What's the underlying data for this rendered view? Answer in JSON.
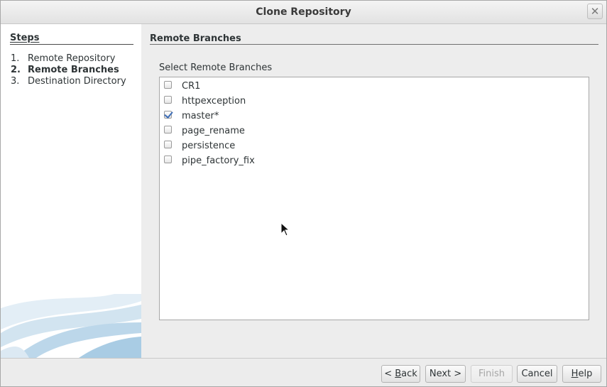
{
  "window": {
    "title": "Clone Repository",
    "close_glyph": "✕"
  },
  "steps": {
    "heading": "Steps",
    "items": [
      {
        "num": "1.",
        "label": "Remote Repository",
        "current": false
      },
      {
        "num": "2.",
        "label": "Remote Branches",
        "current": true
      },
      {
        "num": "3.",
        "label": "Destination Directory",
        "current": false
      }
    ]
  },
  "main": {
    "section_title": "Remote Branches",
    "list_label": "Select Remote Branches",
    "branches": [
      {
        "label": "CR1",
        "checked": false
      },
      {
        "label": "httpexception",
        "checked": false
      },
      {
        "label": "master*",
        "checked": true
      },
      {
        "label": "page_rename",
        "checked": false
      },
      {
        "label": "persistence",
        "checked": false
      },
      {
        "label": "pipe_factory_fix",
        "checked": false
      }
    ]
  },
  "buttons": {
    "back": {
      "label": "< Back",
      "enabled": true
    },
    "next": {
      "label": "Next >",
      "enabled": true
    },
    "finish": {
      "label": "Finish",
      "enabled": false
    },
    "cancel": {
      "label": "Cancel",
      "enabled": true
    },
    "help": {
      "label": "Help",
      "enabled": true
    }
  },
  "colors": {
    "checkmark": "#3f6fb8",
    "panel_bg": "#ffffff",
    "dialog_bg": "#ededed"
  }
}
